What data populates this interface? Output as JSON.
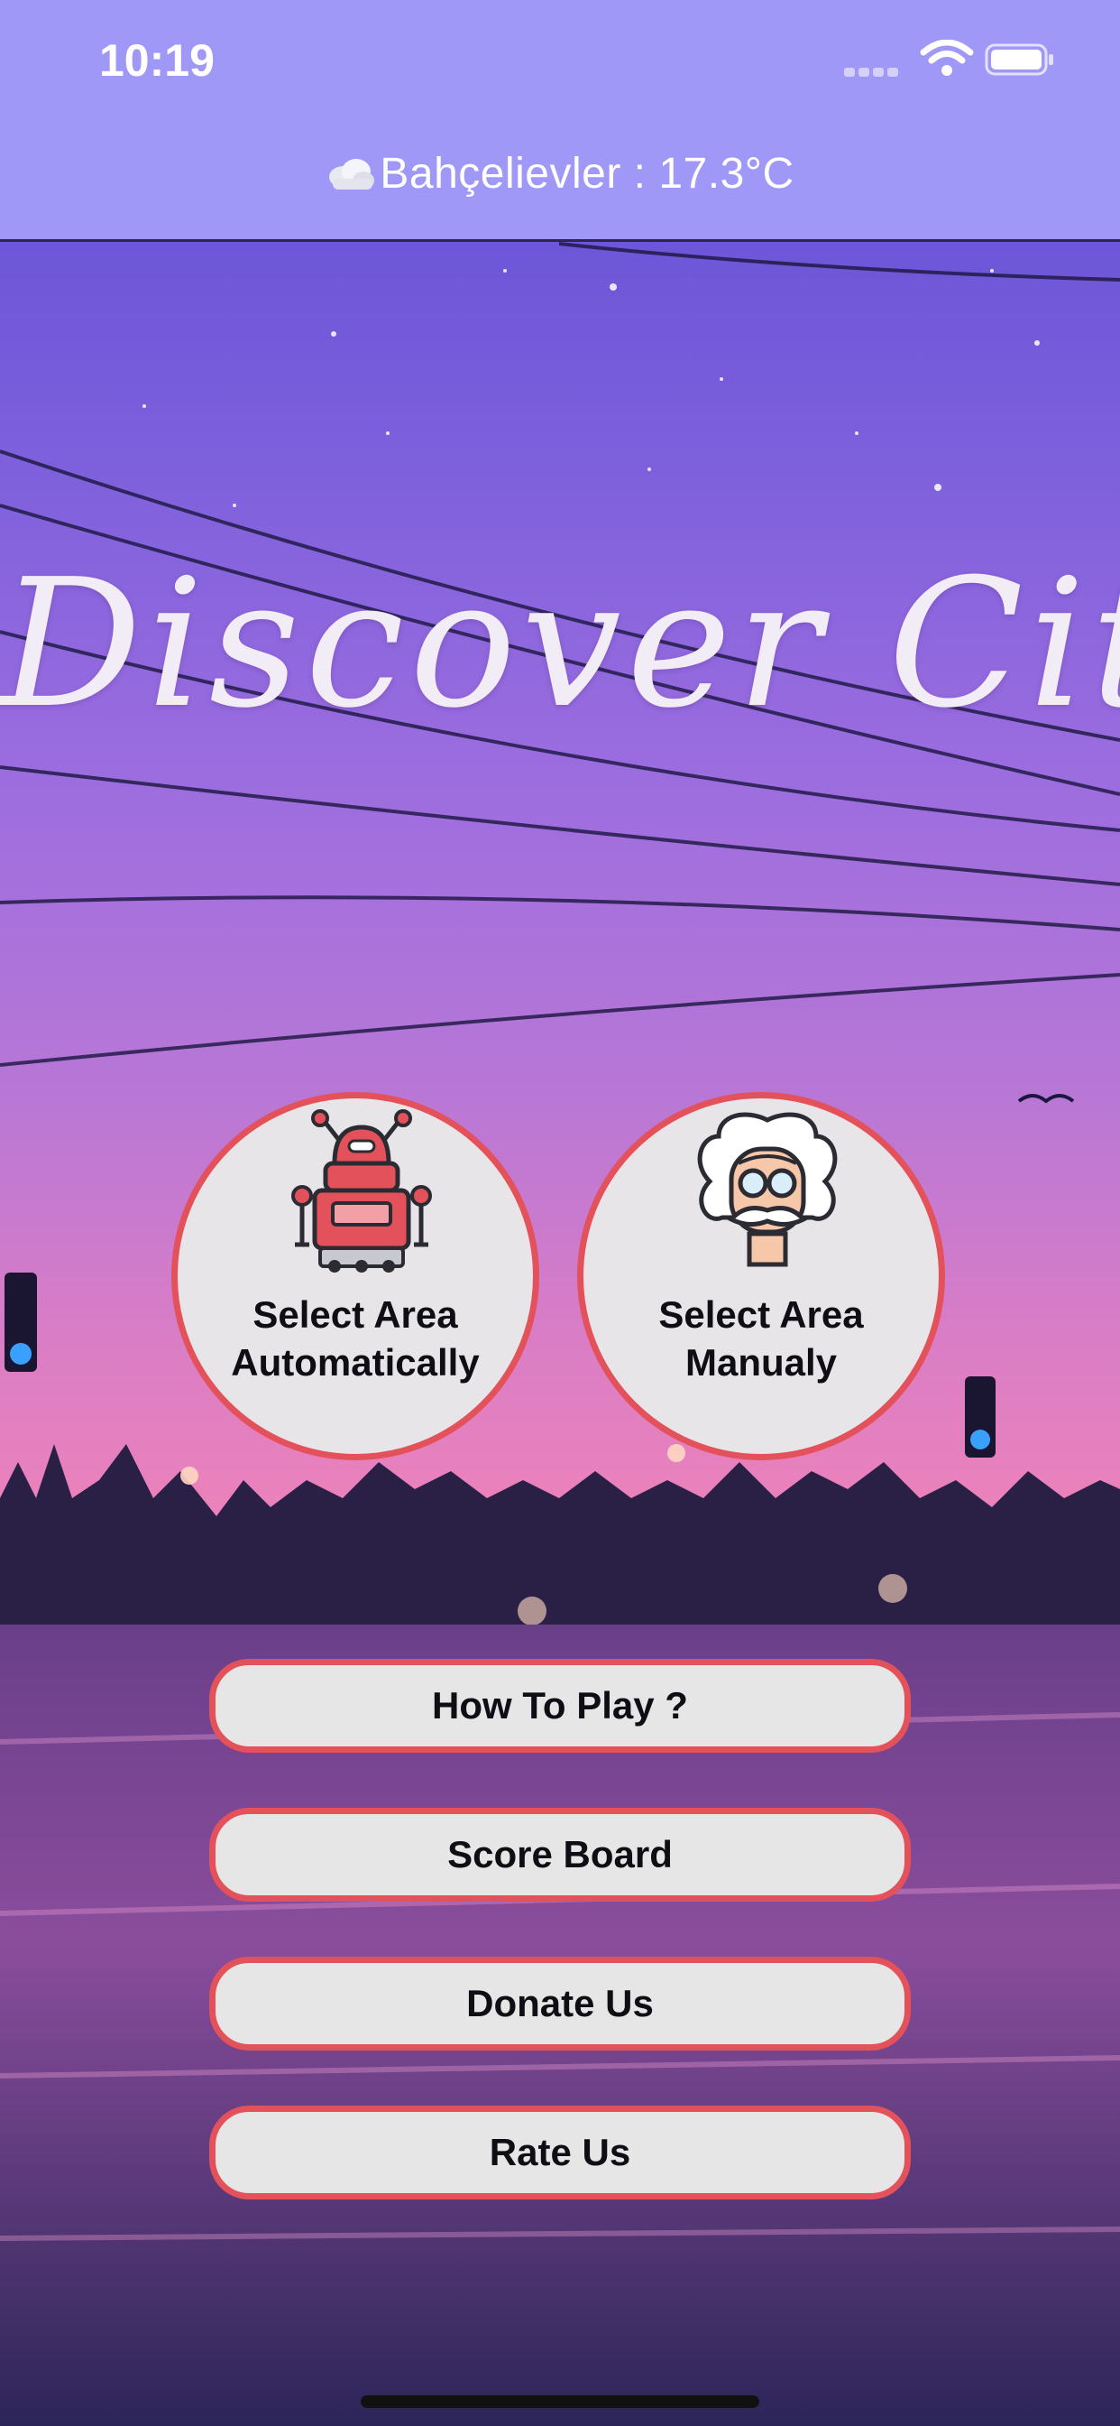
{
  "status_bar": {
    "time": "10:19"
  },
  "header": {
    "weather_text": "Bahçelievler : 17.3°C"
  },
  "title": "Discover City's",
  "mode_buttons": [
    {
      "label_line1": "Select Area",
      "label_line2": "Automatically",
      "icon": "robot-icon"
    },
    {
      "label_line1": "Select Area",
      "label_line2": "Manualy",
      "icon": "scientist-icon"
    }
  ],
  "menu": {
    "how_to_play": "How To Play ?",
    "score_board": "Score Board",
    "donate_us": "Donate Us",
    "rate_us": "Rate Us"
  },
  "colors": {
    "header_bg": "#9f98f6",
    "accent_border": "#e3525a",
    "button_bg": "#e6e6e6"
  }
}
